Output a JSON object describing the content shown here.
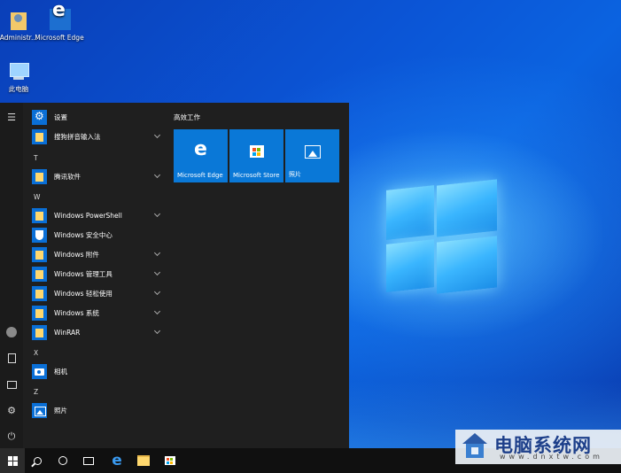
{
  "desktop": {
    "icons": [
      {
        "label": "Administr..."
      },
      {
        "label": "Microsoft Edge"
      },
      {
        "label": "此电脑"
      }
    ]
  },
  "start_menu": {
    "apps": [
      {
        "label": "设置",
        "expandable": false
      },
      {
        "label": "搜狗拼音输入法",
        "expandable": true
      },
      {
        "letter": "T"
      },
      {
        "label": "腾讯软件",
        "expandable": true
      },
      {
        "letter": "W"
      },
      {
        "label": "Windows PowerShell",
        "expandable": true
      },
      {
        "label": "Windows 安全中心",
        "expandable": false
      },
      {
        "label": "Windows 附件",
        "expandable": true
      },
      {
        "label": "Windows 管理工具",
        "expandable": true
      },
      {
        "label": "Windows 轻松使用",
        "expandable": true
      },
      {
        "label": "Windows 系统",
        "expandable": true
      },
      {
        "label": "WinRAR",
        "expandable": true
      },
      {
        "letter": "X"
      },
      {
        "label": "相机",
        "expandable": false
      },
      {
        "letter": "Z"
      },
      {
        "label": "照片",
        "expandable": false
      }
    ],
    "group_title": "高效工作",
    "tiles": [
      {
        "label": "Microsoft Edge",
        "icon": "edge-icon"
      },
      {
        "label": "Microsoft Store",
        "icon": "store-icon"
      },
      {
        "label": "照片",
        "icon": "photos-icon"
      }
    ]
  },
  "taskbar": {
    "buttons": [
      "start-icon",
      "search-icon",
      "cortana-icon",
      "task-view-icon",
      "edge-icon",
      "file-explorer-icon",
      "store-icon"
    ]
  },
  "watermark": {
    "title": "电脑系统网",
    "url": "www.dnxtw.com"
  },
  "colors": {
    "accent": "#0a78d7",
    "menu_bg": "#1f1f1f",
    "taskbar_bg": "#101010",
    "folder": "#ffd86e"
  }
}
